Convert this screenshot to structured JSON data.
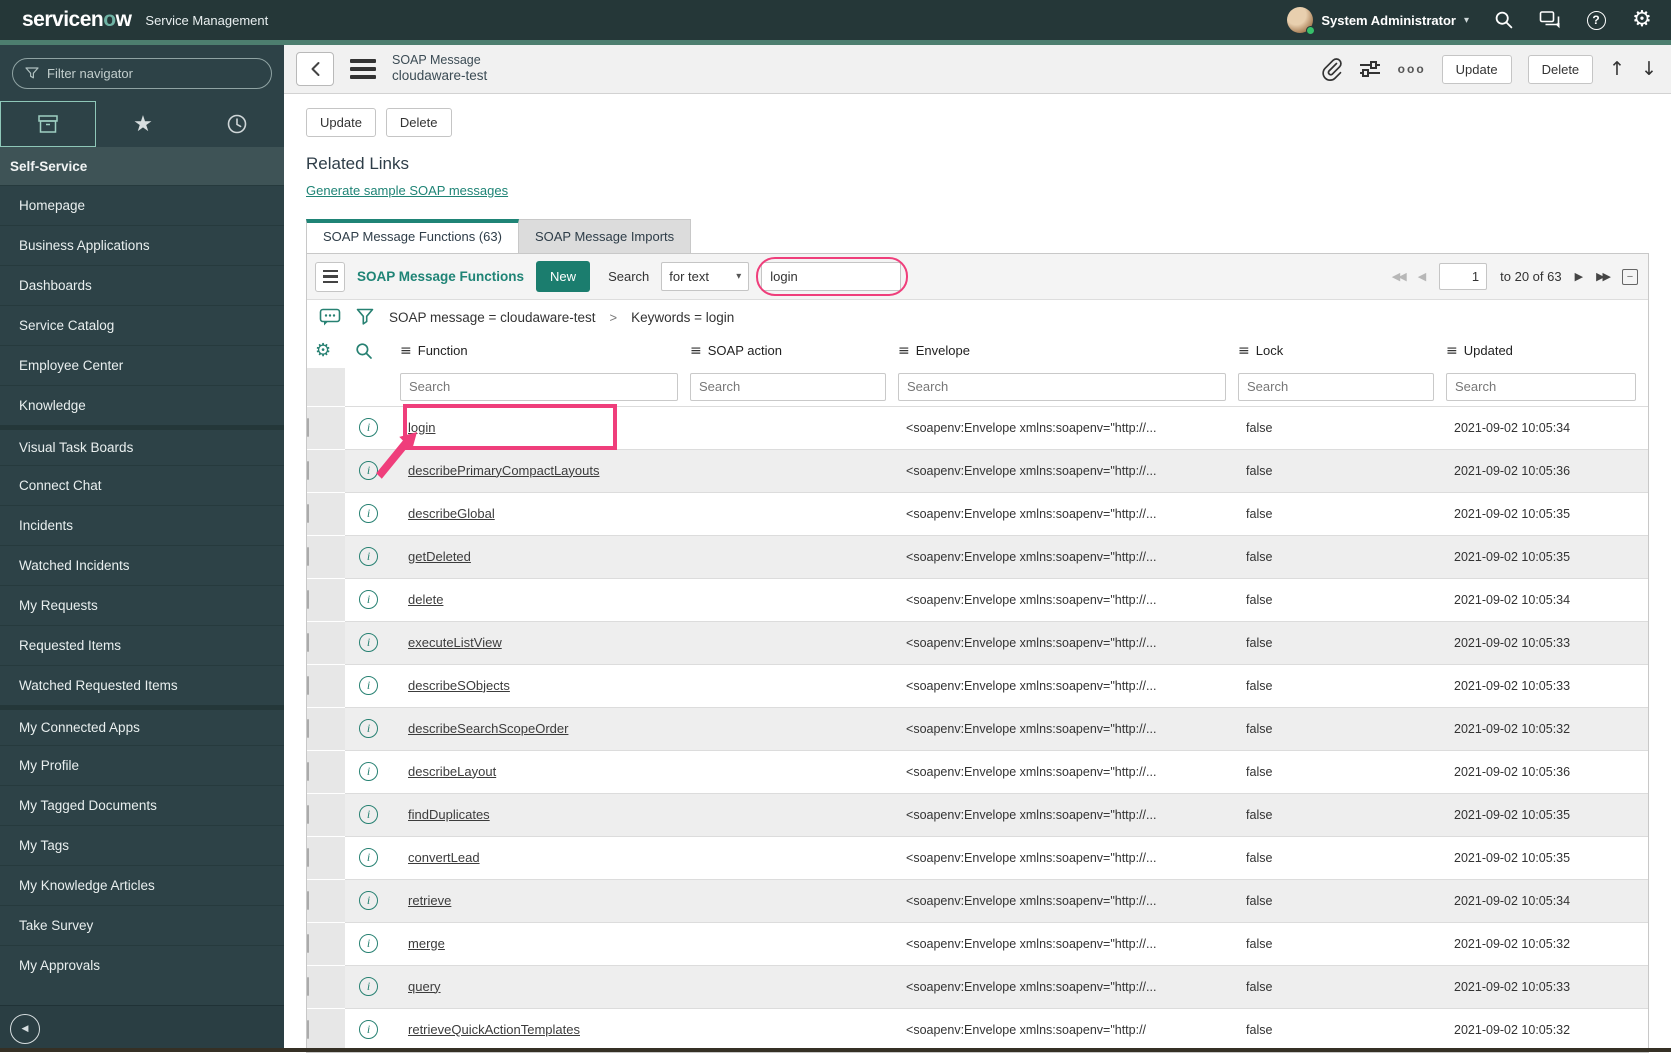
{
  "banner": {
    "logo": {
      "text_pre": "servicen",
      "text_o": "o",
      "text_post": "w"
    },
    "product": "Service Management",
    "user_name": "System Administrator"
  },
  "icons": {
    "more": "ooo",
    "caret": "▾",
    "first": "◀◀",
    "prev": "◀",
    "next": "▶",
    "last": "▶▶",
    "up": "↑",
    "down": "↓",
    "star": "★",
    "menu": "≡",
    "gear": "⚙",
    "info": "i",
    "collapse": "◀",
    "minimize": "−",
    "help": "?"
  },
  "sidebar": {
    "filter_placeholder": "Filter navigator",
    "sections": [
      {
        "label": "Self-Service",
        "items": [
          {
            "label": "Homepage"
          },
          {
            "label": "Business Applications"
          },
          {
            "label": "Dashboards"
          },
          {
            "label": "Service Catalog"
          },
          {
            "label": "Employee Center"
          },
          {
            "label": "Knowledge"
          },
          {
            "label": "Visual Task Boards",
            "group_start": true
          },
          {
            "label": "Connect Chat"
          },
          {
            "label": "Incidents"
          },
          {
            "label": "Watched Incidents"
          },
          {
            "label": "My Requests"
          },
          {
            "label": "Requested Items"
          },
          {
            "label": "Watched Requested Items"
          },
          {
            "label": "My Connected Apps",
            "group_start": true
          },
          {
            "label": "My Profile"
          },
          {
            "label": "My Tagged Documents"
          },
          {
            "label": "My Tags"
          },
          {
            "label": "My Knowledge Articles"
          },
          {
            "label": "Take Survey"
          },
          {
            "label": "My Approvals"
          }
        ]
      }
    ]
  },
  "record_header": {
    "title_top": "SOAP Message",
    "title_sub": "cloudaware-test",
    "update_label": "Update",
    "delete_label": "Delete"
  },
  "form": {
    "update_label": "Update",
    "delete_label": "Delete",
    "related_heading": "Related Links",
    "related_link": "Generate sample SOAP messages"
  },
  "tabs": [
    {
      "label": "SOAP Message Functions (63)",
      "active": true
    },
    {
      "label": "SOAP Message Imports",
      "active": false
    }
  ],
  "list": {
    "title": "SOAP Message Functions",
    "new_label": "New",
    "search_label": "Search",
    "search_type": "for text",
    "search_value": "login",
    "pagination": {
      "page": "1",
      "range": "to 20 of 63"
    },
    "breadcrumb": {
      "part1": "SOAP message = cloudaware-test",
      "separator": ">",
      "part2": "Keywords = login"
    },
    "columns": [
      "Function",
      "SOAP action",
      "Envelope",
      "Lock",
      "Updated"
    ],
    "column_search_placeholder": "Search",
    "rows": [
      {
        "function": "login",
        "soap_action": "",
        "envelope": "<soapenv:Envelope xmlns:soapenv=\"http://...",
        "lock": "false",
        "updated": "2021-09-02 10:05:34"
      },
      {
        "function": "describePrimaryCompactLayouts",
        "soap_action": "",
        "envelope": "<soapenv:Envelope xmlns:soapenv=\"http://...",
        "lock": "false",
        "updated": "2021-09-02 10:05:36"
      },
      {
        "function": "describeGlobal",
        "soap_action": "",
        "envelope": "<soapenv:Envelope xmlns:soapenv=\"http://...",
        "lock": "false",
        "updated": "2021-09-02 10:05:35"
      },
      {
        "function": "getDeleted",
        "soap_action": "",
        "envelope": "<soapenv:Envelope xmlns:soapenv=\"http://...",
        "lock": "false",
        "updated": "2021-09-02 10:05:35"
      },
      {
        "function": "delete",
        "soap_action": "",
        "envelope": "<soapenv:Envelope xmlns:soapenv=\"http://...",
        "lock": "false",
        "updated": "2021-09-02 10:05:34"
      },
      {
        "function": "executeListView",
        "soap_action": "",
        "envelope": "<soapenv:Envelope xmlns:soapenv=\"http://...",
        "lock": "false",
        "updated": "2021-09-02 10:05:33"
      },
      {
        "function": "describeSObjects",
        "soap_action": "",
        "envelope": "<soapenv:Envelope xmlns:soapenv=\"http://...",
        "lock": "false",
        "updated": "2021-09-02 10:05:33"
      },
      {
        "function": "describeSearchScopeOrder",
        "soap_action": "",
        "envelope": "<soapenv:Envelope xmlns:soapenv=\"http://...",
        "lock": "false",
        "updated": "2021-09-02 10:05:32"
      },
      {
        "function": "describeLayout",
        "soap_action": "",
        "envelope": "<soapenv:Envelope xmlns:soapenv=\"http://...",
        "lock": "false",
        "updated": "2021-09-02 10:05:36"
      },
      {
        "function": "findDuplicates",
        "soap_action": "",
        "envelope": "<soapenv:Envelope xmlns:soapenv=\"http://...",
        "lock": "false",
        "updated": "2021-09-02 10:05:35"
      },
      {
        "function": "convertLead",
        "soap_action": "",
        "envelope": "<soapenv:Envelope xmlns:soapenv=\"http://...",
        "lock": "false",
        "updated": "2021-09-02 10:05:35"
      },
      {
        "function": "retrieve",
        "soap_action": "",
        "envelope": "<soapenv:Envelope xmlns:soapenv=\"http://...",
        "lock": "false",
        "updated": "2021-09-02 10:05:34"
      },
      {
        "function": "merge",
        "soap_action": "",
        "envelope": "<soapenv:Envelope xmlns:soapenv=\"http://...",
        "lock": "false",
        "updated": "2021-09-02 10:05:32"
      },
      {
        "function": "query",
        "soap_action": "",
        "envelope": "<soapenv:Envelope xmlns:soapenv=\"http://...",
        "lock": "false",
        "updated": "2021-09-02 10:05:33"
      },
      {
        "function": "retrieveQuickActionTemplates",
        "soap_action": "",
        "envelope": "<soapenv:Envelope xmlns:soapenv=\"http://",
        "lock": "false",
        "updated": "2021-09-02 10:05:32"
      }
    ]
  }
}
